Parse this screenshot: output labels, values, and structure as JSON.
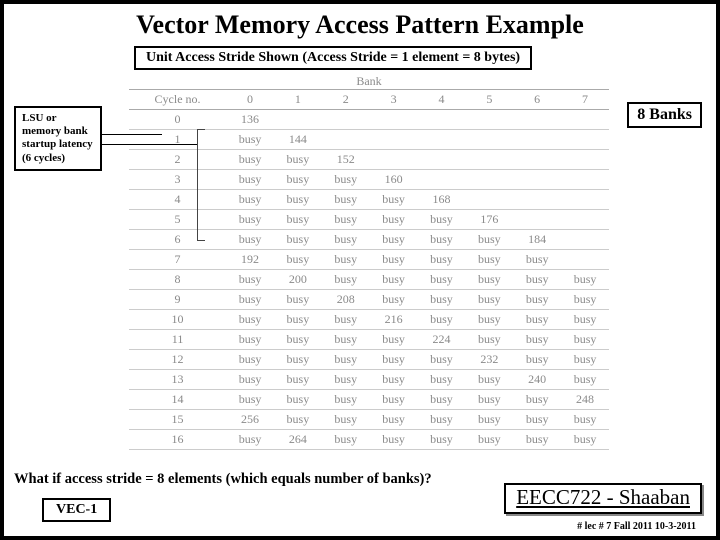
{
  "title": "Vector Memory Access Pattern Example",
  "subtitle": "Unit Access Stride Shown (Access Stride = 1 element = 8 bytes)",
  "lsu_note": "LSU or memory bank startup latency (6 cycles)",
  "banks_label": "8 Banks",
  "bank_header_label": "Bank",
  "cycle_header": "Cycle no.",
  "bank_cols": [
    "0",
    "1",
    "2",
    "3",
    "4",
    "5",
    "6",
    "7"
  ],
  "rows": [
    {
      "c": "0",
      "v": [
        "136",
        "",
        "",
        "",
        "",
        "",
        "",
        ""
      ]
    },
    {
      "c": "1",
      "v": [
        "busy",
        "144",
        "",
        "",
        "",
        "",
        "",
        ""
      ]
    },
    {
      "c": "2",
      "v": [
        "busy",
        "busy",
        "152",
        "",
        "",
        "",
        "",
        ""
      ]
    },
    {
      "c": "3",
      "v": [
        "busy",
        "busy",
        "busy",
        "160",
        "",
        "",
        "",
        ""
      ]
    },
    {
      "c": "4",
      "v": [
        "busy",
        "busy",
        "busy",
        "busy",
        "168",
        "",
        "",
        ""
      ]
    },
    {
      "c": "5",
      "v": [
        "busy",
        "busy",
        "busy",
        "busy",
        "busy",
        "176",
        "",
        ""
      ]
    },
    {
      "c": "6",
      "v": [
        "busy",
        "busy",
        "busy",
        "busy",
        "busy",
        "busy",
        "184",
        ""
      ]
    },
    {
      "c": "7",
      "v": [
        "192",
        "busy",
        "busy",
        "busy",
        "busy",
        "busy",
        "busy",
        ""
      ]
    },
    {
      "c": "8",
      "v": [
        "busy",
        "200",
        "busy",
        "busy",
        "busy",
        "busy",
        "busy",
        "busy"
      ]
    },
    {
      "c": "9",
      "v": [
        "busy",
        "busy",
        "208",
        "busy",
        "busy",
        "busy",
        "busy",
        "busy"
      ]
    },
    {
      "c": "10",
      "v": [
        "busy",
        "busy",
        "busy",
        "216",
        "busy",
        "busy",
        "busy",
        "busy"
      ]
    },
    {
      "c": "11",
      "v": [
        "busy",
        "busy",
        "busy",
        "busy",
        "224",
        "busy",
        "busy",
        "busy"
      ]
    },
    {
      "c": "12",
      "v": [
        "busy",
        "busy",
        "busy",
        "busy",
        "busy",
        "232",
        "busy",
        "busy"
      ]
    },
    {
      "c": "13",
      "v": [
        "busy",
        "busy",
        "busy",
        "busy",
        "busy",
        "busy",
        "240",
        "busy"
      ]
    },
    {
      "c": "14",
      "v": [
        "busy",
        "busy",
        "busy",
        "busy",
        "busy",
        "busy",
        "busy",
        "248"
      ]
    },
    {
      "c": "15",
      "v": [
        "256",
        "busy",
        "busy",
        "busy",
        "busy",
        "busy",
        "busy",
        "busy"
      ]
    },
    {
      "c": "16",
      "v": [
        "busy",
        "264",
        "busy",
        "busy",
        "busy",
        "busy",
        "busy",
        "busy"
      ]
    }
  ],
  "question": "What if access stride = 8 elements (which equals number of banks)?",
  "vec_label": "VEC-1",
  "course_label": "EECC722 - Shaaban",
  "footer": "#  lec # 7    Fall 2011   10-3-2011"
}
